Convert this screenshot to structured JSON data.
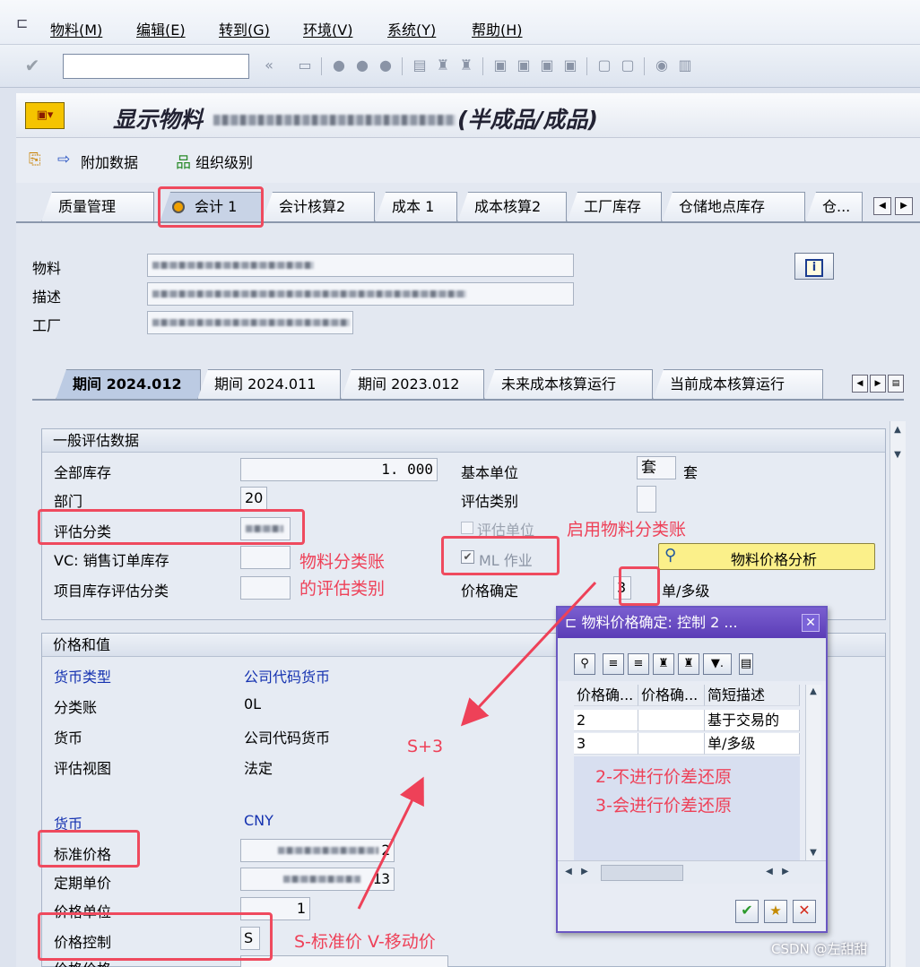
{
  "menu": [
    "物料(M)",
    "编辑(E)",
    "转到(G)",
    "环境(V)",
    "系统(Y)",
    "帮助(H)"
  ],
  "title": {
    "prefix": "显示物料",
    "suffix": "(半成品/成品)"
  },
  "app_toolbar": {
    "additional_data": "附加数据",
    "org_levels": "组织级别"
  },
  "tabs": [
    "质量管理",
    "会计 1",
    "会计核算2",
    "成本 1",
    "成本核算2",
    "工厂库存",
    "仓储地点库存",
    "仓..."
  ],
  "header_fields": {
    "material_label": "物料",
    "desc_label": "描述",
    "plant_label": "工厂"
  },
  "period_tabs": [
    "期间 2024.012",
    "期间 2024.011",
    "期间 2023.012",
    "未来成本核算运行",
    "当前成本核算运行"
  ],
  "general": {
    "title": "一般评估数据",
    "total_stock_label": "全部库存",
    "total_stock": "1. 000",
    "base_unit_label": "基本单位",
    "base_unit": "套",
    "base_unit_text": "套",
    "division_label": "部门",
    "division": "20",
    "valuation_cat_label": "评估类别",
    "valuation_class_label": "评估分类",
    "valuated_unit_label": "评估单位",
    "vc_label": "VC: 销售订单库存",
    "ml_label": "ML 作业",
    "project_label": "项目库存评估分类",
    "price_det_label": "价格确定",
    "price_det": "3",
    "price_det_text": "单/多级",
    "analysis_button": "物料价格分析"
  },
  "prices": {
    "title": "价格和值",
    "currency_type_label": "货币类型",
    "currency_type": "公司代码货币",
    "ledger_label": "分类账",
    "ledger": "0L",
    "currency_label": "货币",
    "currency": "公司代码货币",
    "view_label": "评估视图",
    "view": "法定",
    "curr_label": "货币",
    "curr": "CNY",
    "std_price_label": "标准价格",
    "std_price_tail": "2",
    "periodic_label": "定期单价",
    "periodic_tail": "13",
    "price_unit_label": "价格单位",
    "price_unit": "1",
    "price_ctrl_label": "价格控制",
    "price_ctrl": "S",
    "last_label": "价格价格"
  },
  "popup": {
    "title": "物料价格确定: 控制 2 ...",
    "cols": [
      "价格确...",
      "价格确...",
      "简短描述"
    ],
    "rows": [
      [
        "2",
        "",
        "基于交易的"
      ],
      [
        "3",
        "",
        "单/多级"
      ]
    ]
  },
  "annotations": {
    "ml_enable": "启用物料分类账",
    "ml_class_1": "物料分类账",
    "ml_class_2": "的评估类别",
    "s3": "S+3",
    "no_rev": "2-不进行价差还原",
    "rev": "3-会进行价差还原",
    "ctrl": "S-标准价 V-移动价"
  },
  "watermark": "CSDN @左甜甜"
}
